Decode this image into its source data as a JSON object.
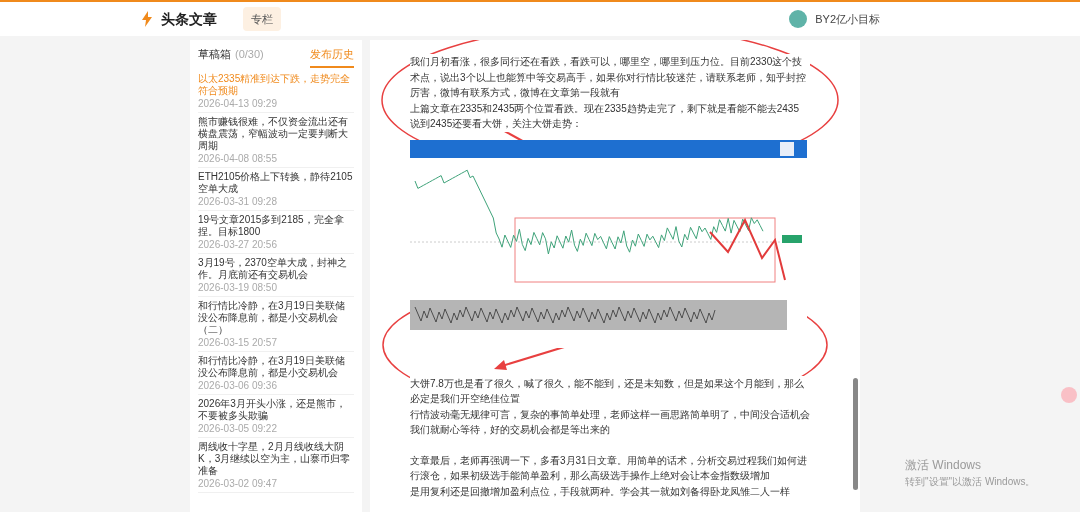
{
  "header": {
    "title": "头条文章",
    "tab": "专栏",
    "user": "BY2亿小目标"
  },
  "sidebar": {
    "tabs": [
      {
        "label": "草稿箱",
        "count": "(0/30)",
        "selected": false
      },
      {
        "label": "发布历史",
        "selected": true
      }
    ],
    "items": [
      {
        "title": "以太2335精准到达下跌，走势完全符合预期",
        "date": "2026-04-13 09:29",
        "selected": true
      },
      {
        "title": "熊市赚钱很难，不仅资金流出还有横盘震荡，窄幅波动一定要判断大周期",
        "date": "2026-04-08 08:55",
        "selected": false
      },
      {
        "title": "ETH2105价格上下转换，静待2105空单大成",
        "date": "2026-03-31 09:28",
        "selected": false
      },
      {
        "title": "19号文章2015多到2185，完全拿捏。目标1800",
        "date": "2026-03-27 20:56",
        "selected": false
      },
      {
        "title": "3月19号，2370空单大成，封神之作。月底前还有交易机会",
        "date": "2026-03-19 08:50",
        "selected": false
      },
      {
        "title": "和行情比冷静，在3月19日美联储没公布降息前，都是小交易机会（二）",
        "date": "2026-03-15 20:57",
        "selected": false
      },
      {
        "title": "和行情比冷静，在3月19日美联储没公布降息前，都是小交易机会",
        "date": "2026-03-06 09:36",
        "selected": false
      },
      {
        "title": "2026年3月开头小涨，还是熊市，不要被多头欺骗",
        "date": "2026-03-05 09:22",
        "selected": false
      },
      {
        "title": "周线收十字星，2月月线收线大阴K，3月继续以空为主，山寨币归零准备",
        "date": "2026-03-02 09:47",
        "selected": false
      }
    ]
  },
  "article": {
    "paragraphs_top": [
      "我们月初看涨，很多同行还在看跌，看跌可以，哪里空，哪里到压力位。目前2330这个技术点，说出3个以上也能算中等交易高手，如果你对行情比较迷茫，请联系老师，知乎封控厉害，微博有联系方式，微博在文章第一段就有",
      "上篇文章在2335和2435两个位置看跌。现在2335趋势走完了，剩下就是看能不能去2435",
      "说到2435还要看大饼，关注大饼走势："
    ],
    "paragraphs_middle": [
      "大饼7.8万也是看了很久，喊了很久，能不能到，还是未知数，但是如果这个月能到，那么必定是我们开空绝佳位置",
      "行情波动毫无规律可言，复杂的事简单处理，老师这样一画思路简单明了，中间没合适机会我们就耐心等待，好的交易机会都是等出来的"
    ],
    "paragraphs_end": [
      "文章最后，老师再强调一下，多看3月31日文章。用简单的话术，分析交易过程我们如何进行滚仓，如果初级选手能简单盈利，那么高级选手操作上绝对会让本金指数级增加",
      "是用复利还是回撤增加盈利点位，手段就两种。学会其一就如刘备得卧龙凤雏二人一样"
    ]
  },
  "windows_watermark": {
    "title": "激活 Windows",
    "subtitle": "转到\"设置\"以激活 Windows。"
  }
}
